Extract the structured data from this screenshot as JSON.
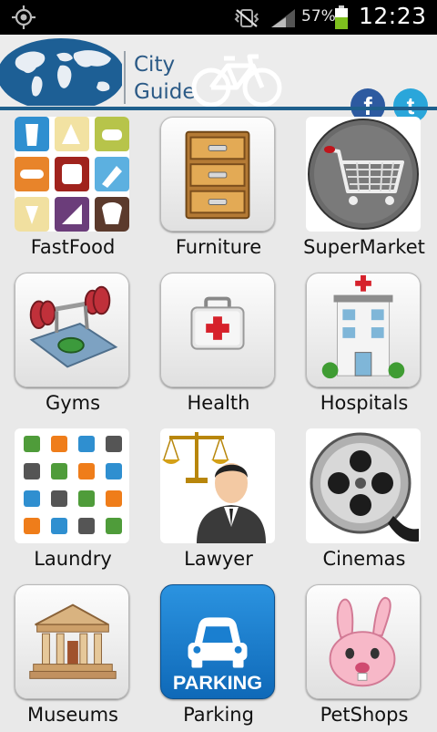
{
  "status_bar": {
    "battery_percent": "57%",
    "time": "12:23"
  },
  "header": {
    "title_line1": "City",
    "title_line2": "Guide",
    "facebook_letter": "f",
    "twitter_letter": "t"
  },
  "categories": [
    {
      "label": "FastFood",
      "icon": "fastfood-icon"
    },
    {
      "label": "Furniture",
      "icon": "drawer-cabinet-icon"
    },
    {
      "label": "SuperMarket",
      "icon": "shopping-cart-icon"
    },
    {
      "label": "Gyms",
      "icon": "barbell-icon"
    },
    {
      "label": "Health",
      "icon": "first-aid-kit-icon"
    },
    {
      "label": "Hospitals",
      "icon": "hospital-building-icon"
    },
    {
      "label": "Laundry",
      "icon": "laundry-symbols-icon"
    },
    {
      "label": "Lawyer",
      "icon": "lawyer-scales-icon"
    },
    {
      "label": "Cinemas",
      "icon": "film-reel-icon"
    },
    {
      "label": "Museums",
      "icon": "museum-building-icon"
    },
    {
      "label": "Parking",
      "icon": "parking-car-icon",
      "caption": "PARKING"
    },
    {
      "label": "PetShops",
      "icon": "bunny-icon"
    }
  ],
  "colors": {
    "header_blue": "#2b5a86",
    "divider": "#1f5f8c",
    "facebook": "#2d5aa0",
    "twitter": "#2aa6da",
    "parking": "#1a7fd0",
    "battery": "#7fc01e"
  }
}
